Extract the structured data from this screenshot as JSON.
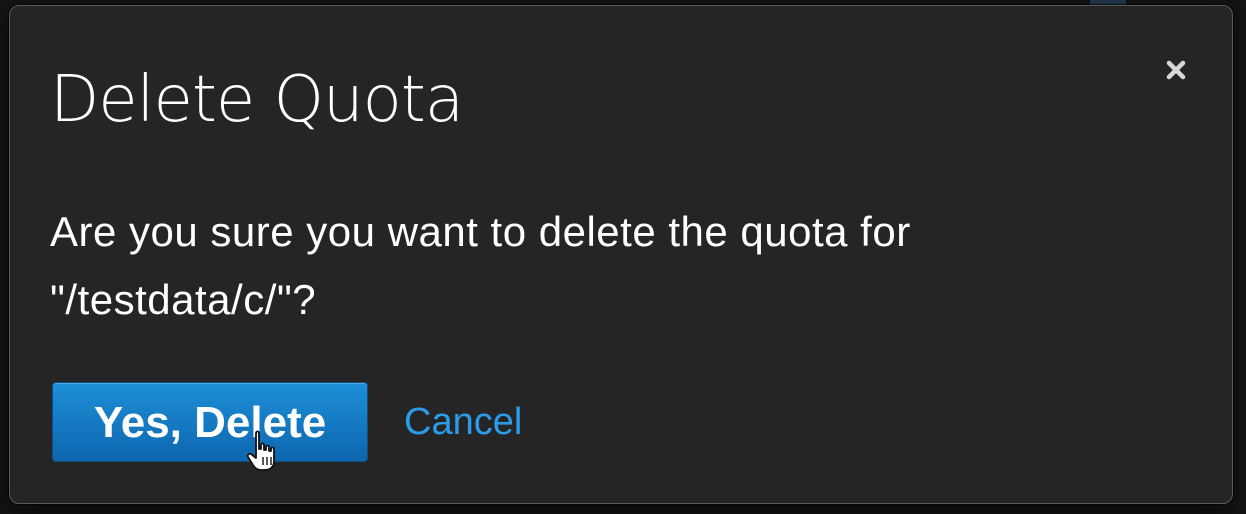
{
  "dialog": {
    "title": "Delete Quota",
    "message_line1": "Are you sure you want to delete the quota for",
    "message_line2": "\"/testdata/c/\"?",
    "confirm_label": "Yes, Delete",
    "cancel_label": "Cancel",
    "close_icon": "close-icon",
    "pointer_icon": "hand-pointer-icon"
  },
  "colors": {
    "dialog_background": "#252525",
    "dialog_border": "#5a5a5a",
    "text": "#ffffff",
    "primary_button": "#1d8fd8",
    "link": "#2b9ce8"
  }
}
